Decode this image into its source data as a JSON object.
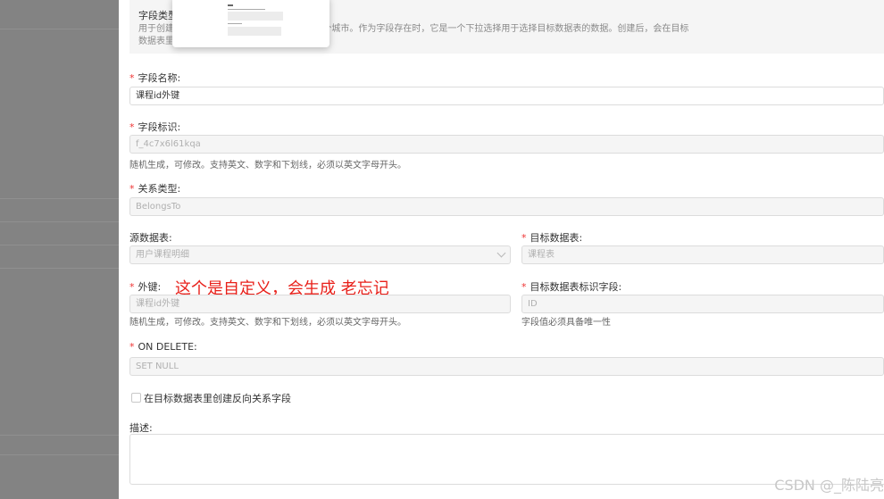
{
  "info": {
    "title": "字段类型",
    "desc_line1": "用于创建         ，     属于一个国家，一个国家可以有多个城市。作为字段存在时，它是一个下拉选择用于选择目标数据表的数据。创建后，会在目标",
    "desc_line2": "数据表里"
  },
  "field_name": {
    "label": "字段名称:",
    "value": "课程id外键"
  },
  "field_id": {
    "label": "字段标识:",
    "value": "f_4c7x6l61kqa",
    "hint": "随机生成，可修改。支持英文、数字和下划线，必须以英文字母开头。"
  },
  "relation_type": {
    "label": "关系类型:",
    "value": "BelongsTo"
  },
  "source_table": {
    "label": "源数据表:",
    "value": "用户课程明细"
  },
  "target_table": {
    "label": "目标数据表:",
    "value": "课程表"
  },
  "foreign_key": {
    "label": "外键:",
    "value": "课程id外键",
    "hint": "随机生成，可修改。支持英文、数字和下划线，必须以英文字母开头。"
  },
  "annotation": "这个是自定义，会生成 老忘记",
  "target_key": {
    "label": "目标数据表标识字段:",
    "value": "ID",
    "hint": "字段值必须具备唯一性"
  },
  "on_delete": {
    "label": "ON DELETE:",
    "value": "SET NULL"
  },
  "reverse": {
    "label": "在目标数据表里创建反向关系字段"
  },
  "description": {
    "label": "描述:"
  },
  "watermark": "CSDN @_陈陆亮",
  "colors": {
    "required": "#e33333",
    "annotation": "#e8201a"
  }
}
